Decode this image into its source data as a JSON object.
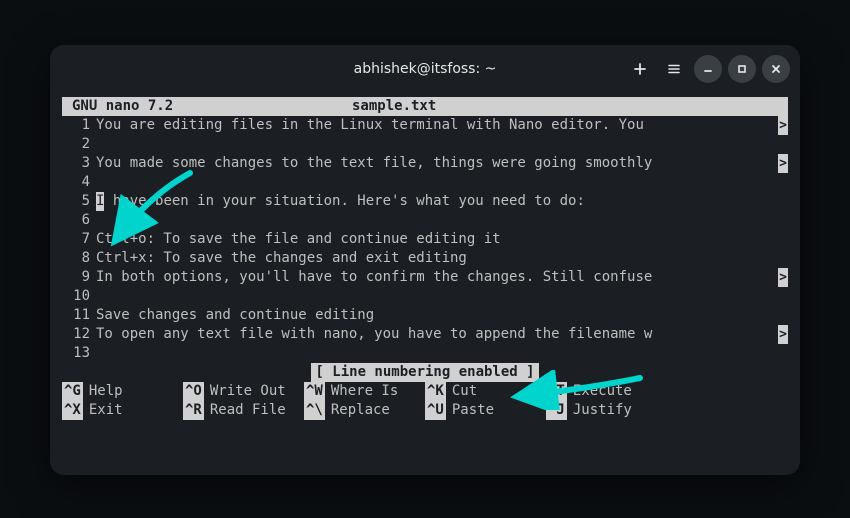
{
  "window": {
    "title": "abhishek@itsfoss: ~"
  },
  "nano": {
    "version": "GNU nano 7.2",
    "filename": "sample.txt",
    "status": "[ Line numbering enabled ]"
  },
  "lines": [
    {
      "n": "1",
      "text": "You are editing files in the Linux terminal with Nano editor. You ",
      "trunc": true
    },
    {
      "n": "2",
      "text": "",
      "trunc": false
    },
    {
      "n": "3",
      "text": "You made some changes to the text file, things were going smoothly",
      "trunc": true
    },
    {
      "n": "4",
      "text": "",
      "trunc": false
    },
    {
      "n": "5",
      "text": "I have been in your situation. Here's what you need to do:",
      "trunc": false,
      "cursor": true
    },
    {
      "n": "6",
      "text": "",
      "trunc": false
    },
    {
      "n": "7",
      "text": "Ctrl+o: To save the file and continue editing it",
      "trunc": false
    },
    {
      "n": "8",
      "text": "Ctrl+x: To save the changes and exit editing",
      "trunc": false
    },
    {
      "n": "9",
      "text": "In both options, you'll have to confirm the changes. Still confuse",
      "trunc": true
    },
    {
      "n": "10",
      "text": "",
      "trunc": false
    },
    {
      "n": "11",
      "text": "Save changes and continue editing",
      "trunc": false
    },
    {
      "n": "12",
      "text": "To open any text file with nano, you have to append the filename w",
      "trunc": true
    },
    {
      "n": "13",
      "text": "",
      "trunc": false
    }
  ],
  "shortcuts": [
    {
      "key": "^G",
      "label": "Help"
    },
    {
      "key": "^O",
      "label": "Write Out"
    },
    {
      "key": "^W",
      "label": "Where Is"
    },
    {
      "key": "^K",
      "label": "Cut"
    },
    {
      "key": "^T",
      "label": "Execute"
    },
    {
      "key": "",
      "label": ""
    },
    {
      "key": "^X",
      "label": "Exit"
    },
    {
      "key": "^R",
      "label": "Read File"
    },
    {
      "key": "^\\",
      "label": "Replace"
    },
    {
      "key": "^U",
      "label": "Paste"
    },
    {
      "key": "^J",
      "label": "Justify"
    },
    {
      "key": "",
      "label": ""
    }
  ],
  "annotations": {
    "color": "#00d4cc"
  }
}
